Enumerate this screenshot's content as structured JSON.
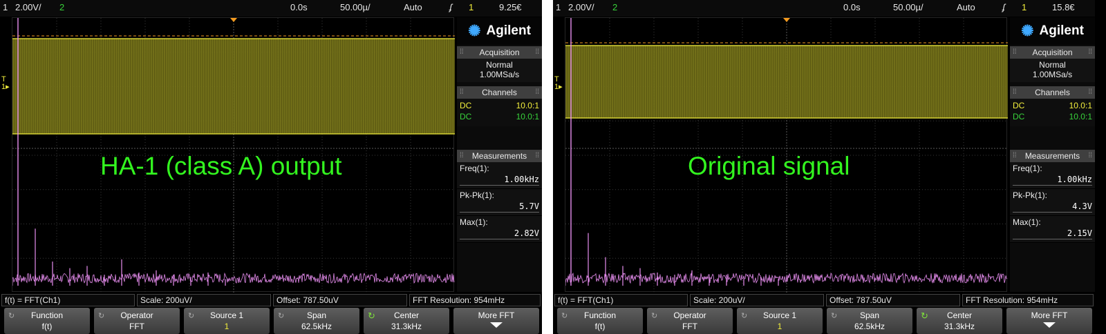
{
  "panels": [
    {
      "topbar": {
        "ch1_num": "1",
        "ch1_scale": "2.00V/",
        "ch2_num": "2",
        "time_pos": "0.0s",
        "time_scale": "50.00µ/",
        "trigger_mode": "Auto",
        "trig_icon": "trigger-edge-icon",
        "trig_src": "1",
        "trig_level": "9.25€"
      },
      "overlay_text": "HA-1 (class A) output",
      "fft_peaks": [
        1.0,
        0.26,
        0.11,
        0.08,
        0.09,
        0.05,
        0.12,
        0.06,
        0.07,
        0.05,
        0.04,
        0.06,
        0.03
      ],
      "sidebar": {
        "brand": "Agilent",
        "acq_header": "Acquisition",
        "acq_mode": "Normal",
        "acq_rate": "1.00MSa/s",
        "channels_header": "Channels",
        "channels": [
          {
            "coupling": "DC",
            "probe": "10.0:1",
            "color": "#f3ef3c"
          },
          {
            "coupling": "DC",
            "probe": "10.0:1",
            "color": "#38d33b"
          }
        ],
        "meas_header": "Measurements",
        "measurements": [
          {
            "label": "Freq(1):",
            "value": "1.00kHz"
          },
          {
            "label": "Pk-Pk(1):",
            "value": "5.7V"
          },
          {
            "label": "Max(1):",
            "value": "2.82V"
          }
        ]
      },
      "status": {
        "fn": "f(t) = FFT(Ch1)",
        "scale": "Scale: 200uV/",
        "offset": "Offset: 787.50uV",
        "res": "FFT Resolution: 954mHz"
      },
      "softkeys": [
        {
          "label": "Function",
          "value": "f(t)"
        },
        {
          "label": "Operator",
          "value": "FFT"
        },
        {
          "label": "Source 1",
          "value": "1"
        },
        {
          "label": "Span",
          "value": "62.5kHz"
        },
        {
          "label": "Center",
          "value": "31.3kHz"
        },
        {
          "label": "More FFT",
          "value": ""
        }
      ]
    },
    {
      "topbar": {
        "ch1_num": "1",
        "ch1_scale": "2.00V/",
        "ch2_num": "2",
        "time_pos": "0.0s",
        "time_scale": "50.00µ/",
        "trigger_mode": "Auto",
        "trig_icon": "trigger-edge-icon",
        "trig_src": "1",
        "trig_level": "15.8€"
      },
      "overlay_text": "Original signal",
      "fft_peaks": [
        1.0,
        0.24,
        0.13,
        0.09,
        0.08,
        0.06,
        0.05,
        0.07,
        0.04,
        0.05,
        0.03,
        0.04,
        0.03
      ],
      "sidebar": {
        "brand": "Agilent",
        "acq_header": "Acquisition",
        "acq_mode": "Normal",
        "acq_rate": "1.00MSa/s",
        "channels_header": "Channels",
        "channels": [
          {
            "coupling": "DC",
            "probe": "10.0:1",
            "color": "#f3ef3c"
          },
          {
            "coupling": "DC",
            "probe": "10.0:1",
            "color": "#38d33b"
          }
        ],
        "meas_header": "Measurements",
        "measurements": [
          {
            "label": "Freq(1):",
            "value": "1.00kHz"
          },
          {
            "label": "Pk-Pk(1):",
            "value": "4.3V"
          },
          {
            "label": "Max(1):",
            "value": "2.15V"
          }
        ]
      },
      "status": {
        "fn": "f(t) = FFT(Ch1)",
        "scale": "Scale: 200uV/",
        "offset": "Offset: 787.50uV",
        "res": "FFT Resolution: 954mHz"
      },
      "softkeys": [
        {
          "label": "Function",
          "value": "f(t)"
        },
        {
          "label": "Operator",
          "value": "FFT"
        },
        {
          "label": "Source 1",
          "value": "1"
        },
        {
          "label": "Span",
          "value": "62.5kHz"
        },
        {
          "label": "Center",
          "value": "31.3kHz"
        },
        {
          "label": "More FFT",
          "value": ""
        }
      ]
    }
  ],
  "colors": {
    "ch1": "#f3ef3c",
    "ch2": "#38d33b",
    "math": "#e88ef0",
    "overlay": "#33f51f"
  }
}
